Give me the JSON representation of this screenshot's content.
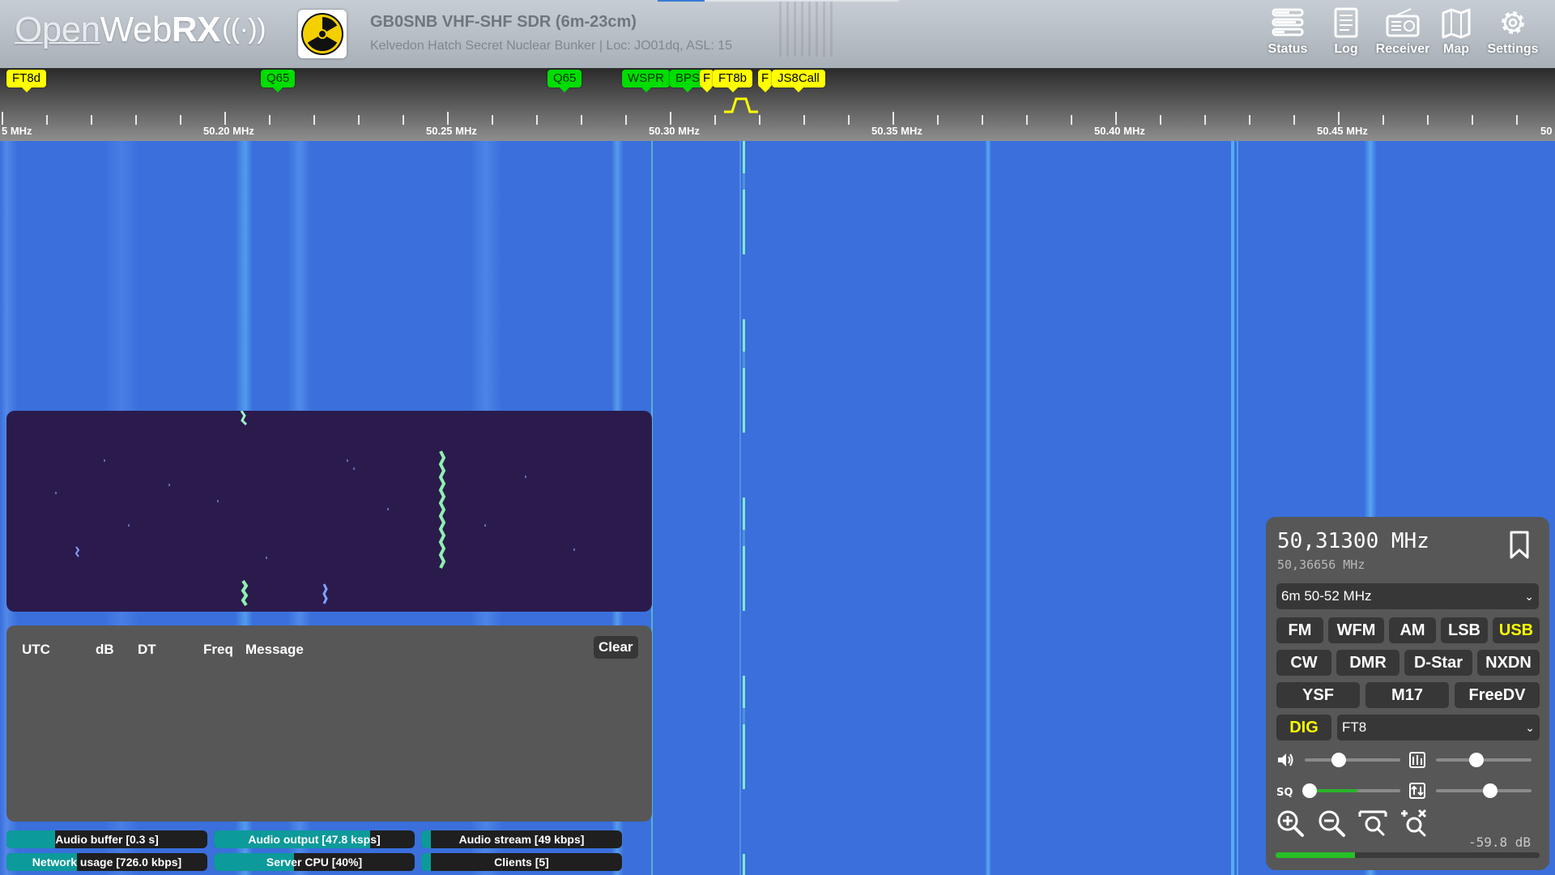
{
  "header": {
    "logo_part1": "Open",
    "logo_part2": "Web",
    "logo_part3": "RX",
    "receiver_name": "GB0SNB VHF-SHF SDR (6m-23cm)",
    "receiver_desc": "Kelvedon Hatch Secret Nuclear Bunker | Loc: JO01dq, ASL: 15",
    "nav": [
      {
        "label": "Status",
        "icon": "status-icon"
      },
      {
        "label": "Log",
        "icon": "log-icon"
      },
      {
        "label": "Receiver",
        "icon": "receiver-icon"
      },
      {
        "label": "Map",
        "icon": "map-icon"
      },
      {
        "label": "Settings",
        "icon": "gear-icon"
      }
    ]
  },
  "bookmarks": [
    {
      "label": "FT8d",
      "color": "yellow"
    },
    {
      "label": "Q65",
      "color": "green"
    },
    {
      "label": "Q65",
      "color": "green"
    },
    {
      "label": "WSPR",
      "color": "green"
    },
    {
      "label": "BPS",
      "color": "green"
    },
    {
      "label": "F",
      "color": "yellow"
    },
    {
      "label": "FT8b",
      "color": "yellow"
    },
    {
      "label": "F",
      "color": "yellow"
    },
    {
      "label": "JS8Call",
      "color": "yellow"
    }
  ],
  "scale": {
    "labels": [
      "5 MHz",
      "50.20 MHz",
      "50.25 MHz",
      "50.30 MHz",
      "50.35 MHz",
      "50.40 MHz",
      "50.45 MHz",
      "50"
    ]
  },
  "messages": {
    "columns": [
      "UTC",
      "dB",
      "DT",
      "Freq",
      "Message"
    ],
    "clear_label": "Clear"
  },
  "status": {
    "audio_buffer": {
      "label": "Audio buffer [0.3 s]",
      "level": 0.24
    },
    "audio_output": {
      "label": "Audio output [47.8 ksps]",
      "level": 0.78
    },
    "audio_stream": {
      "label": "Audio stream [49 kbps]",
      "level": 0.05
    },
    "network_usage": {
      "label": "Network usage [726.0 kbps]",
      "level": 0.35
    },
    "server_cpu": {
      "label": "Server CPU [40%]",
      "level": 0.4
    },
    "clients": {
      "label": "Clients [5]",
      "level": 0.05
    }
  },
  "receiver": {
    "frequency": "50,31300 MHz",
    "frequency_sub": "50,36656 MHz",
    "band": "6m 50-52 MHz",
    "modes_row1": [
      "FM",
      "WFM",
      "AM",
      "LSB",
      "USB"
    ],
    "modes_row2": [
      "CW",
      "DMR",
      "D-Star",
      "NXDN"
    ],
    "modes_row3": [
      "YSF",
      "M17",
      "FreeDV"
    ],
    "active_mode": "USB",
    "dig_label": "DIG",
    "digital_mode": "FT8",
    "volume": 0.36,
    "nr_level": 0.42,
    "squelch": 0.05,
    "gain_level": 0.57,
    "smeter_text": "-59.8 dB",
    "smeter_level": 0.3
  }
}
